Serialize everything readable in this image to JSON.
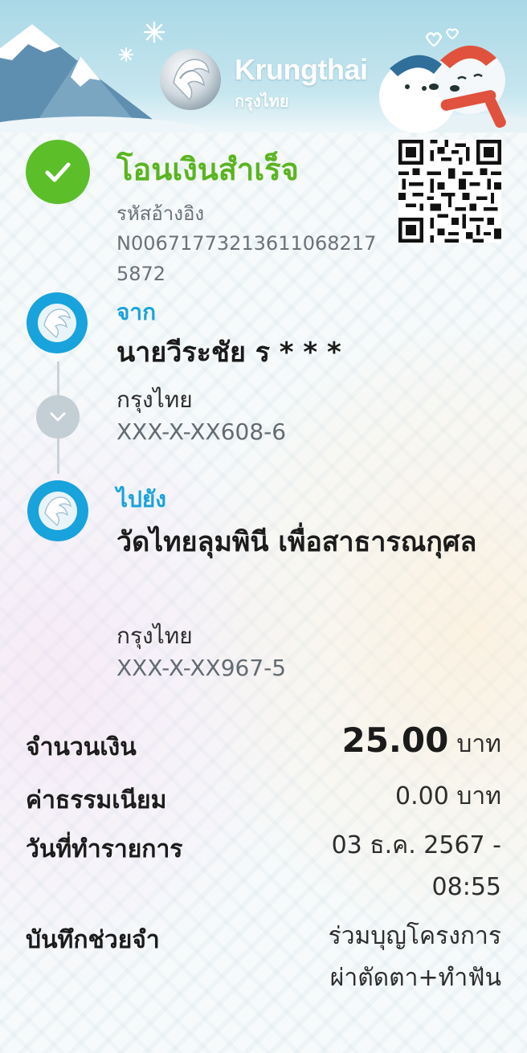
{
  "header": {
    "brand_name": "Krungthai",
    "brand_thai": "กรุงไทย"
  },
  "status": {
    "title": "โอนเงินสำเร็จ",
    "ref_label": "รหัสอ้างอิง",
    "ref_number": "N006717732136110682175872"
  },
  "from": {
    "label": "จาก",
    "name": "นายวีระชัย ร * * *",
    "bank": "กรุงไทย",
    "account": "XXX-X-XX608-6"
  },
  "to": {
    "label": "ไปยัง",
    "name": "วัดไทยลุมพินี เพื่อสาธารณกุศล",
    "bank": "กรุงไทย",
    "account": "XXX-X-XX967-5"
  },
  "details": {
    "amount_label": "จำนวนเงิน",
    "amount_value": "25.00",
    "amount_unit": "บาท",
    "fee_label": "ค่าธรรมเนียม",
    "fee_value": "0.00 บาท",
    "date_label": "วันที่ทำรายการ",
    "date_value": "03 ธ.ค. 2567 - 08:55",
    "memo_label": "บันทึกช่วยจำ",
    "memo_value": "ร่วมบุญโครงการผ่าตัดตา+ทำฟัน"
  },
  "colors": {
    "success_green": "#5cbf2a",
    "brand_blue": "#18a3dc",
    "header_sky": "#a9d8e6"
  },
  "icons": {
    "success": "check-icon",
    "from_avatar": "krungthai-logo-icon",
    "to_avatar": "krungthai-logo-icon",
    "flow": "chevron-down-icon",
    "qr": "qr-code-icon"
  }
}
